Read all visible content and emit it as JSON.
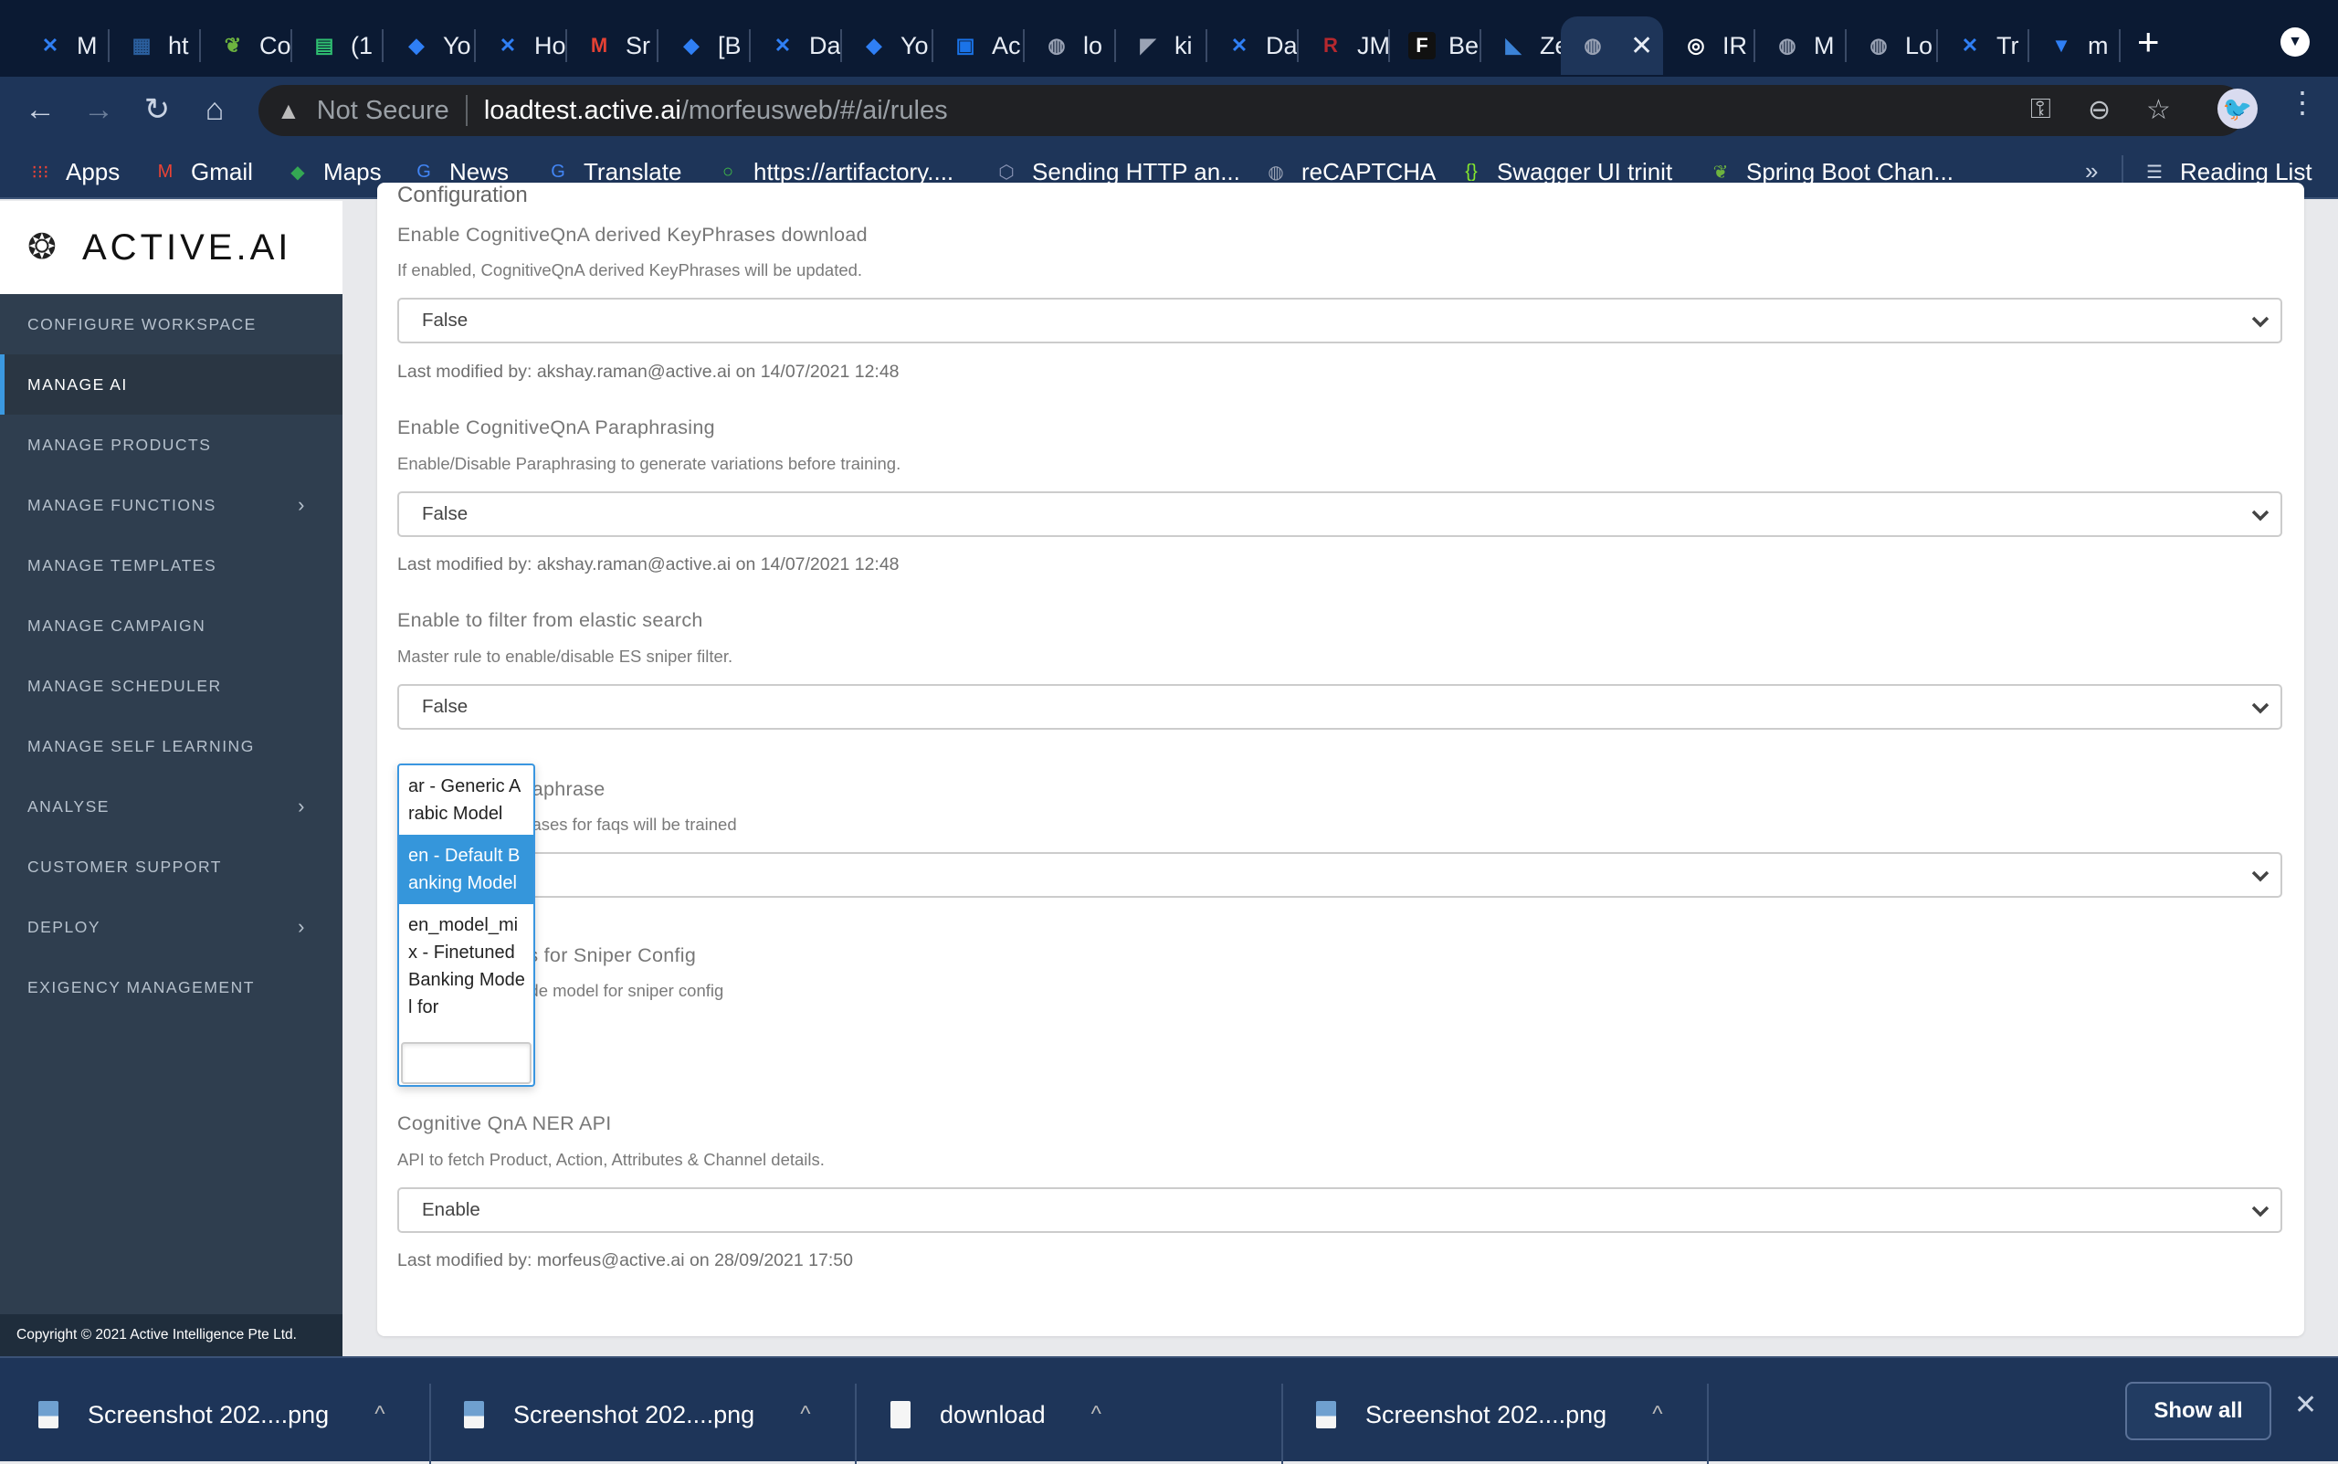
{
  "browser": {
    "tabs": [
      {
        "label": "M",
        "icon": "confluence-icon",
        "color": "#2f7ff5"
      },
      {
        "label": "ht",
        "icon": "grid-app-icon",
        "color": "#2b5f9e"
      },
      {
        "label": "Co",
        "icon": "spring-icon",
        "color": "#6db33f"
      },
      {
        "label": "(1",
        "icon": "chat-icon",
        "color": "#2fbf71"
      },
      {
        "label": "Yo",
        "icon": "jira-icon",
        "color": "#2f7ff5"
      },
      {
        "label": "Ho",
        "icon": "confluence-icon",
        "color": "#2f7ff5"
      },
      {
        "label": "Sr",
        "icon": "gmail-100-icon",
        "color": "#e44134"
      },
      {
        "label": "[B",
        "icon": "jira-icon",
        "color": "#2f7ff5"
      },
      {
        "label": "Da",
        "icon": "confluence-icon",
        "color": "#2f7ff5"
      },
      {
        "label": "Yo",
        "icon": "jira-icon",
        "color": "#2f7ff5"
      },
      {
        "label": "Ac",
        "icon": "calendar-icon",
        "color": "#1a73e8"
      },
      {
        "label": "lo",
        "icon": "globe-icon",
        "color": "#9aa3b5"
      },
      {
        "label": "ki",
        "icon": "kibana-icon",
        "color": "#9aa3b5"
      },
      {
        "label": "Da",
        "icon": "confluence-icon",
        "color": "#2f7ff5"
      },
      {
        "label": "JM",
        "icon": "r-icon",
        "color": "#b5282e"
      },
      {
        "label": "Be",
        "icon": "f-icon",
        "color": "#222222"
      },
      {
        "label": "Ze",
        "icon": "zeplin-icon",
        "color": "#3b82d6"
      },
      {
        "label": "",
        "icon": "globe-icon",
        "color": "#9aa3b5",
        "active": true
      },
      {
        "label": "IR",
        "icon": "ir-icon",
        "color": "#ffffff"
      },
      {
        "label": "M",
        "icon": "globe-icon",
        "color": "#9aa3b5"
      },
      {
        "label": "Lo",
        "icon": "globe-icon",
        "color": "#9aa3b5"
      },
      {
        "label": "Tr",
        "icon": "confluence-icon",
        "color": "#2f7ff5"
      },
      {
        "label": "m",
        "icon": "bitbucket-icon",
        "color": "#2f7ff5"
      }
    ],
    "url": {
      "security": "Not Secure",
      "host": "loadtest.active.ai",
      "path": "/morfeusweb/#/ai/rules"
    },
    "bookmarks": [
      {
        "label": "Apps",
        "icon": "apps-grid-icon"
      },
      {
        "label": "Gmail",
        "icon": "gmail-icon"
      },
      {
        "label": "Maps",
        "icon": "maps-icon"
      },
      {
        "label": "News",
        "icon": "news-icon"
      },
      {
        "label": "Translate",
        "icon": "translate-icon"
      },
      {
        "label": "https://artifactory....",
        "icon": "artifactory-icon"
      },
      {
        "label": "Sending HTTP an...",
        "icon": "hex-icon"
      },
      {
        "label": "reCAPTCHA",
        "icon": "globe-icon"
      },
      {
        "label": "Swagger UI trinit",
        "icon": "swagger-icon"
      },
      {
        "label": "Spring Boot Chan...",
        "icon": "spring-leaf-icon"
      }
    ],
    "bookmarks_more": "»",
    "reading_list": "Reading List"
  },
  "app": {
    "brand": "ACTIVE.AI",
    "menu": [
      {
        "label": "CONFIGURE WORKSPACE",
        "chevron": false
      },
      {
        "label": "MANAGE AI",
        "chevron": false,
        "active": true
      },
      {
        "label": "MANAGE PRODUCTS",
        "chevron": false
      },
      {
        "label": "MANAGE FUNCTIONS",
        "chevron": true
      },
      {
        "label": "MANAGE TEMPLATES",
        "chevron": false
      },
      {
        "label": "MANAGE CAMPAIGN",
        "chevron": false
      },
      {
        "label": "MANAGE SCHEDULER",
        "chevron": false
      },
      {
        "label": "MANAGE SELF LEARNING",
        "chevron": false
      },
      {
        "label": "ANALYSE",
        "chevron": true
      },
      {
        "label": "CUSTOMER SUPPORT",
        "chevron": false
      },
      {
        "label": "DEPLOY",
        "chevron": true
      },
      {
        "label": "EXIGENCY MANAGEMENT",
        "chevron": false
      }
    ],
    "copyright": "Copyright © 2021 Active Intelligence Pte Ltd.",
    "accent": "#3b99e0"
  },
  "config": {
    "section_title": "Configuration",
    "fields": [
      {
        "label": "Enable CognitiveQnA derived KeyPhrases download",
        "description": "If enabled, CognitiveQnA derived KeyPhrases will be updated.",
        "value": "False",
        "meta": "Last modified by: akshay.raman@active.ai on 14/07/2021 12:48"
      },
      {
        "label": "Enable CognitiveQnA Paraphrasing",
        "description": "Enable/Disable Paraphrasing to generate variations before training.",
        "value": "False",
        "meta": "Last modified by: akshay.raman@active.ai on 14/07/2021 12:48"
      },
      {
        "label": "Enable to filter from elastic search",
        "description": "Master rule to enable/disable ES sniper filter.",
        "value": "False",
        "meta": ""
      },
      {
        "label": "araphrase",
        "description": "hrases for faqs will be trained",
        "value": "",
        "meta": ""
      },
      {
        "label": "els for Sniper Config",
        "description": "rride model for sniper config",
        "value": "",
        "meta": ""
      },
      {
        "label": "Cognitive QnA NER API",
        "description": "API to fetch Product, Action, Attributes & Channel details.",
        "value": "Enable",
        "meta": "Last modified by: morfeus@active.ai on 28/09/2021 17:50"
      }
    ],
    "dropdown": {
      "options": [
        {
          "label": "ar - Generic Arabic Model",
          "selected": false
        },
        {
          "label": "en - Default Banking Model",
          "selected": true
        },
        {
          "label": "en_model_mix - Finetuned Banking Model for",
          "selected": false
        }
      ],
      "search_value": ""
    }
  },
  "downloads": {
    "items": [
      {
        "name": "Screenshot 202....png",
        "type": "image"
      },
      {
        "name": "Screenshot 202....png",
        "type": "image"
      },
      {
        "name": "download",
        "type": "file"
      },
      {
        "name": "Screenshot 202....png",
        "type": "image"
      }
    ],
    "show_all": "Show all"
  }
}
